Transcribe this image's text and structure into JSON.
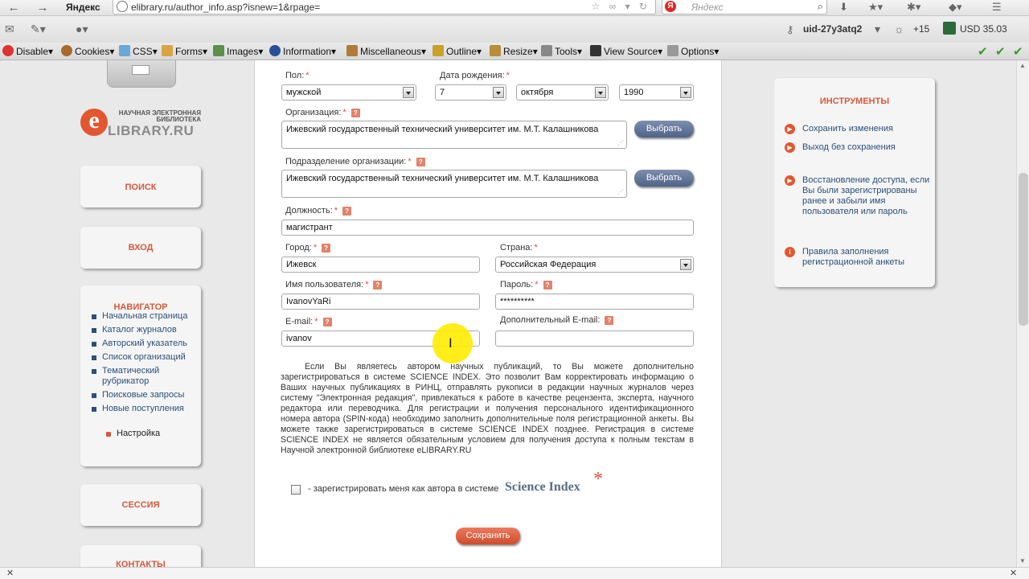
{
  "browser": {
    "brand": "Яндекс",
    "url": "elibrary.ru/author_info.asp?isnew=1&rpage=",
    "search_placeholder": "Яндекс",
    "user_id": "uid-27y3atq2",
    "weather": "+15",
    "currency": "USD 35.03"
  },
  "webdev_toolbar": {
    "items": [
      "Disable",
      "Cookies",
      "CSS",
      "Forms",
      "Images",
      "Information",
      "Miscellaneous",
      "Outline",
      "Resize",
      "Tools",
      "View Source",
      "Options"
    ]
  },
  "site": {
    "logo_small": "НАУЧНАЯ ЭЛЕКТРОННАЯ БИБЛИОТЕКА",
    "logo_big": "LIBRARY.RU",
    "logo_letter": "e"
  },
  "sidebar": {
    "search": "ПОИСК",
    "login": "ВХОД",
    "navigator_title": "НАВИГАТОР",
    "nav_items": [
      "Начальная страница",
      "Каталог журналов",
      "Авторский указатель",
      "Список организаций",
      "Тематический рубрикатор",
      "Поисковые запросы",
      "Новые поступления"
    ],
    "settings": "Настройка",
    "session": "СЕССИЯ",
    "contacts": "КОНТАКТЫ"
  },
  "form": {
    "gender_label": "Пол:",
    "gender_value": "мужской",
    "birth_label": "Дата рождения:",
    "birth_day": "7",
    "birth_month": "октября",
    "birth_year": "1990",
    "org_label": "Организация:",
    "org_value": "Ижевский государственный технический университет им. М.Т. Калашникова",
    "dept_label": "Подразделение организации:",
    "dept_value": "Ижевский государственный технический университет им. М.Т. Калашникова",
    "choose_button": "Выбрать",
    "position_label": "Должность:",
    "position_value": "магистрант",
    "city_label": "Город:",
    "city_value": "Ижевск",
    "country_label": "Страна:",
    "country_value": "Российская Федерация",
    "username_label": "Имя пользователя:",
    "username_value": "IvanovYaRi",
    "password_label": "Пароль:",
    "password_value": "**********",
    "email_label": "E-mail:",
    "email_value": "ivanov",
    "extra_email_label": "Дополнительный E-mail:",
    "extra_email_value": "",
    "help_mark": "?",
    "required_mark": "*",
    "info_text": "Если Вы являетесь автором научных публикаций, то Вы можете дополнительно зарегистрироваться в системе SCIENCE INDEX. Это позволит Вам корректировать информацию о Ваших научных публикациях в РИНЦ, отправлять рукописи в редакции научных журналов через систему \"Электронная редакция\", привлекаться к работе в качестве рецензента, эксперта, научного редактора или переводчика. Для регистрации и получения персонального идентификационного номера автора (SPIN-кода) необходимо заполнить дополнительные поля регистрационной анкеты. Вы можете также зарегистрироваться в системе SCIENCE INDEX позднее. Регистрация в системе SCIENCE INDEX не является обязательным условием для получения доступа к полным текстам в Научной электронной библиотеке eLIBRARY.RU",
    "science_checkbox_label": "- зарегистрировать меня как автора в системе",
    "science_brand": "Science Index",
    "save_button": "Сохранить"
  },
  "tools": {
    "title": "ИНСТРУМЕНТЫ",
    "items": [
      "Сохранить изменения",
      "Выход без сохранения",
      "Восстановление доступа, если Вы были зарегистрированы ранее и забыли имя пользователя или пароль",
      "Правила заполнения регистрационной анкеты"
    ]
  },
  "colors": {
    "accent": "#d9583a",
    "link": "#2a4f7a",
    "button_blue": "#4f6288"
  }
}
